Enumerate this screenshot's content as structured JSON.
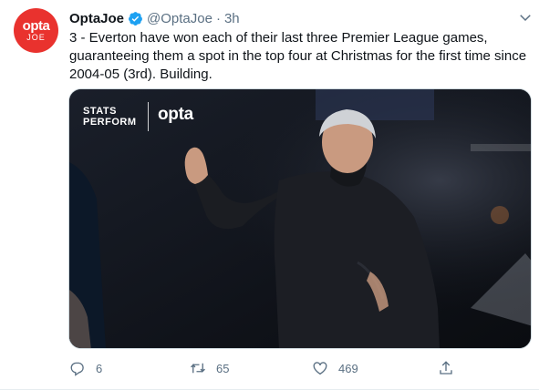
{
  "tweet": {
    "avatar": {
      "brand_top": "opta",
      "brand_bottom": "JOE",
      "bg": "#e9322e"
    },
    "author": {
      "name": "OptaJoe",
      "handle": "@OptaJoe",
      "separator": "·",
      "time": "3h",
      "verified": true
    },
    "text_lines": [
      "3 - Everton have won each of their last three Premier League games,",
      "guaranteeing them a spot in the top four at Christmas for the first time since",
      "2004-05 (3rd). Building."
    ],
    "media": {
      "logo_stats_line1": "STATS",
      "logo_stats_line2": "PERFORM",
      "logo_opta": "opta"
    },
    "actions": {
      "reply_count": "6",
      "retweet_count": "65",
      "like_count": "469"
    },
    "icons": {
      "verified": "verified-badge-icon",
      "caret": "chevron-down-icon",
      "reply": "reply-icon",
      "retweet": "retweet-icon",
      "like": "heart-icon",
      "share": "share-icon"
    },
    "colors": {
      "accent": "#1da1f2",
      "secondary_text": "#5b7083",
      "text": "#0f1419"
    }
  }
}
